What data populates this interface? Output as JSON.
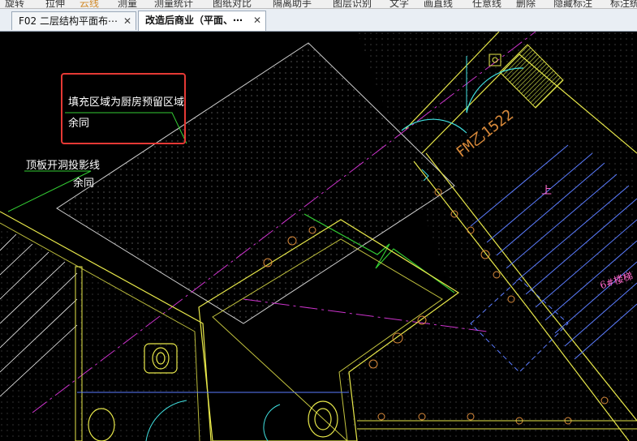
{
  "toolbar": {
    "items": [
      "旋转",
      "拉伸",
      "云线",
      "测量",
      "测量统计",
      "图纸对比",
      "隔离助手",
      "图层识别",
      "文字",
      "画直线",
      "任意线",
      "删除",
      "隐藏标注",
      "标注统计"
    ]
  },
  "tabs": [
    {
      "label": "F02 二层结构平面布⋯",
      "active": false
    },
    {
      "label": "改造后商业（平面、⋯",
      "active": true
    }
  ],
  "annotations": {
    "box_line1": "填充区域为厨房预留区域",
    "box_line2": "余同",
    "left_line1": "顶板开洞投影线",
    "left_line2": "余同",
    "door_tag": "FM乙1522",
    "stair_label": "6#楼梯",
    "up_mark": "上"
  },
  "colors": {
    "canvas_bg": "#000000",
    "wall_yellow": "#e8e84a",
    "door_cyan": "#40e0e0",
    "leader_green": "#33cc33",
    "tag_orange": "#d98a3a",
    "axis_magenta": "#cc33cc",
    "stair_blue": "#5b7cff",
    "box_red": "#e53935"
  }
}
